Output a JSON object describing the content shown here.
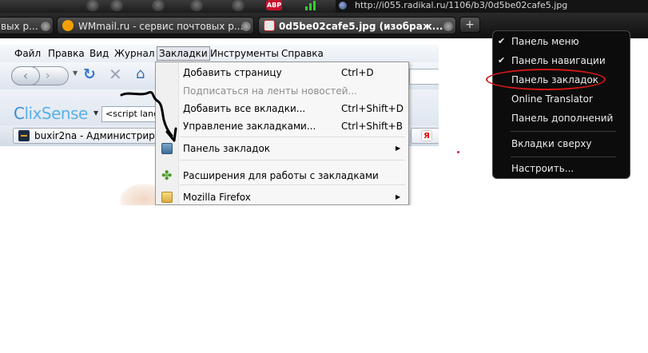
{
  "outer_browser": {
    "url": "http://i055.radikal.ru/1106/b3/0d5be02cafe5.jpg",
    "tabs": [
      {
        "label": "вых р..."
      },
      {
        "label": "WMmail.ru - сервис почтовых р..."
      },
      {
        "label": "0d5be02cafe5.jpg (изображ...",
        "active": true
      }
    ],
    "abp_label": "ABP",
    "new_tab_label": "+"
  },
  "context_menu": {
    "items": [
      {
        "label": "Панель меню",
        "checked": true
      },
      {
        "label": "Панель навигации",
        "checked": true
      },
      {
        "label": "Панель закладок",
        "checked": false,
        "highlighted_by_annotation": true
      },
      {
        "label": "Online Translator",
        "checked": false
      },
      {
        "label": "Панель дополнений",
        "checked": false
      },
      {
        "label": "Вкладки сверху",
        "checked": false
      },
      {
        "label": "Настроить...",
        "checked": false
      }
    ],
    "check_glyph": "✔"
  },
  "inner_firefox": {
    "menubar": [
      "Файл",
      "Правка",
      "Вид",
      "Журнал",
      "Закладки",
      "Инструменты",
      "Справка"
    ],
    "open_menu": "Закладки",
    "clixsense": {
      "logo_prefix": "C",
      "logo_rest": "lixSense",
      "search_value": "<script lang"
    },
    "bookmarks_bar": {
      "item_1": "buxir2na - Администрирова",
      "item_2_icon": "Я"
    }
  },
  "bookmarks_menu": {
    "items": [
      {
        "label": "Добавить страницу",
        "shortcut": "Ctrl+D"
      },
      {
        "label": "Подписаться на ленты новостей...",
        "disabled": true
      },
      {
        "label": "Добавить все вкладки...",
        "shortcut": "Ctrl+Shift+D"
      },
      {
        "label": "Управление закладками...",
        "shortcut": "Ctrl+Shift+B"
      },
      {
        "label": "Панель закладок",
        "submenu": true
      },
      {
        "label": "Расширения для работы с закладками"
      },
      {
        "label": "Mozilla Firefox",
        "submenu": true
      }
    ]
  },
  "colors": {
    "annotation": "#d11818",
    "chrome_dark": "#1c1c1c",
    "accent_blue": "#3a8ed1"
  }
}
